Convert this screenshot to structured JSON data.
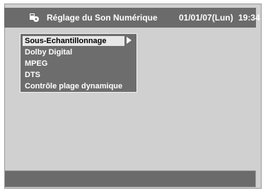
{
  "header": {
    "title": "Réglage du Son Numérique",
    "date": "01/01/07(Lun)",
    "time": "19:34",
    "icon": "disc-settings-icon"
  },
  "menu": {
    "items": [
      {
        "label": "Sous-Echantillonnage",
        "selected": true
      },
      {
        "label": "Dolby Digital",
        "selected": false
      },
      {
        "label": "MPEG",
        "selected": false
      },
      {
        "label": "DTS",
        "selected": false
      },
      {
        "label": "Contrôle plage dynamique",
        "selected": false
      }
    ]
  },
  "colors": {
    "background": "#d0d0d0",
    "bar": "#6b6b6b",
    "menu": "#6d6d6d",
    "selected": "#e8e8e8"
  }
}
